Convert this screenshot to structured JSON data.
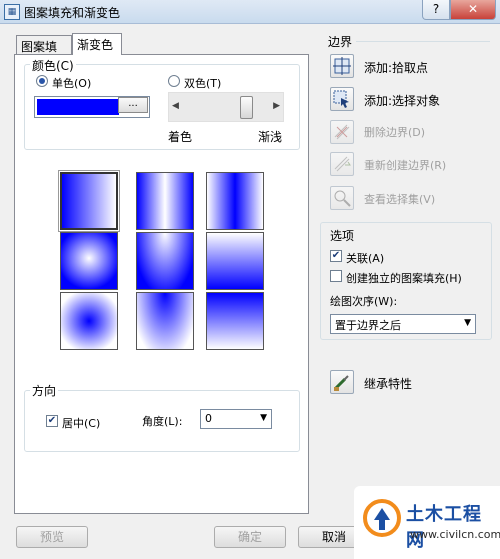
{
  "window": {
    "title": "图案填充和渐变色",
    "help_glyph": "?",
    "close_glyph": "✕",
    "app_icon": "hatch-app-icon"
  },
  "tabs": [
    {
      "label": "图案填充",
      "active": false
    },
    {
      "label": "渐变色",
      "active": true
    }
  ],
  "color_group": {
    "title": "颜色(C)",
    "one_color_label": "单色(O)",
    "two_color_label": "双色(T)",
    "selected": "one_color",
    "swatch_color": "#0000ff",
    "browse_label": "...",
    "shade_label": "着色",
    "tint_label": "渐浅",
    "slider_left_arrow": "◀",
    "slider_right_arrow": "▶",
    "slider_value": 0.78
  },
  "gradient_patterns": [
    "linear",
    "cylinder",
    "inverted-cylinder",
    "spherical",
    "hemispherical",
    "curved",
    "inverted-spherical",
    "inverted-hemispherical",
    "inverted-curved"
  ],
  "gradient_selected_index": 0,
  "orientation_group": {
    "title": "方向",
    "centered_label": "居中(C)",
    "centered_checked": true,
    "angle_label": "角度(L):",
    "angle_value": "0"
  },
  "boundaries": {
    "title": "边界",
    "actions": [
      {
        "label": "添加:拾取点",
        "icon": "pick-point-icon",
        "enabled": true
      },
      {
        "label": "添加:选择对象",
        "icon": "select-objects-icon",
        "enabled": true
      },
      {
        "label": "删除边界(D)",
        "icon": "remove-boundary-icon",
        "enabled": false
      },
      {
        "label": "重新创建边界(R)",
        "icon": "recreate-boundary-icon",
        "enabled": false
      },
      {
        "label": "查看选择集(V)",
        "icon": "view-selection-icon",
        "enabled": false
      }
    ]
  },
  "options": {
    "title": "选项",
    "associative_label": "关联(A)",
    "associative_checked": true,
    "separate_label": "创建独立的图案填充(H)",
    "separate_checked": false,
    "draw_order_label": "绘图次序(W):",
    "draw_order_value": "置于边界之后",
    "inherit_label": "继承特性"
  },
  "buttons": {
    "preview": "预览",
    "ok": "确定",
    "cancel": "取消"
  },
  "watermark": {
    "text": "土木工程网",
    "url": "www.civilcn.com",
    "logo": "civilcn-logo"
  },
  "colors": {
    "gradient_blue": "#0000ff",
    "selection_blue": "#2a55a8"
  }
}
